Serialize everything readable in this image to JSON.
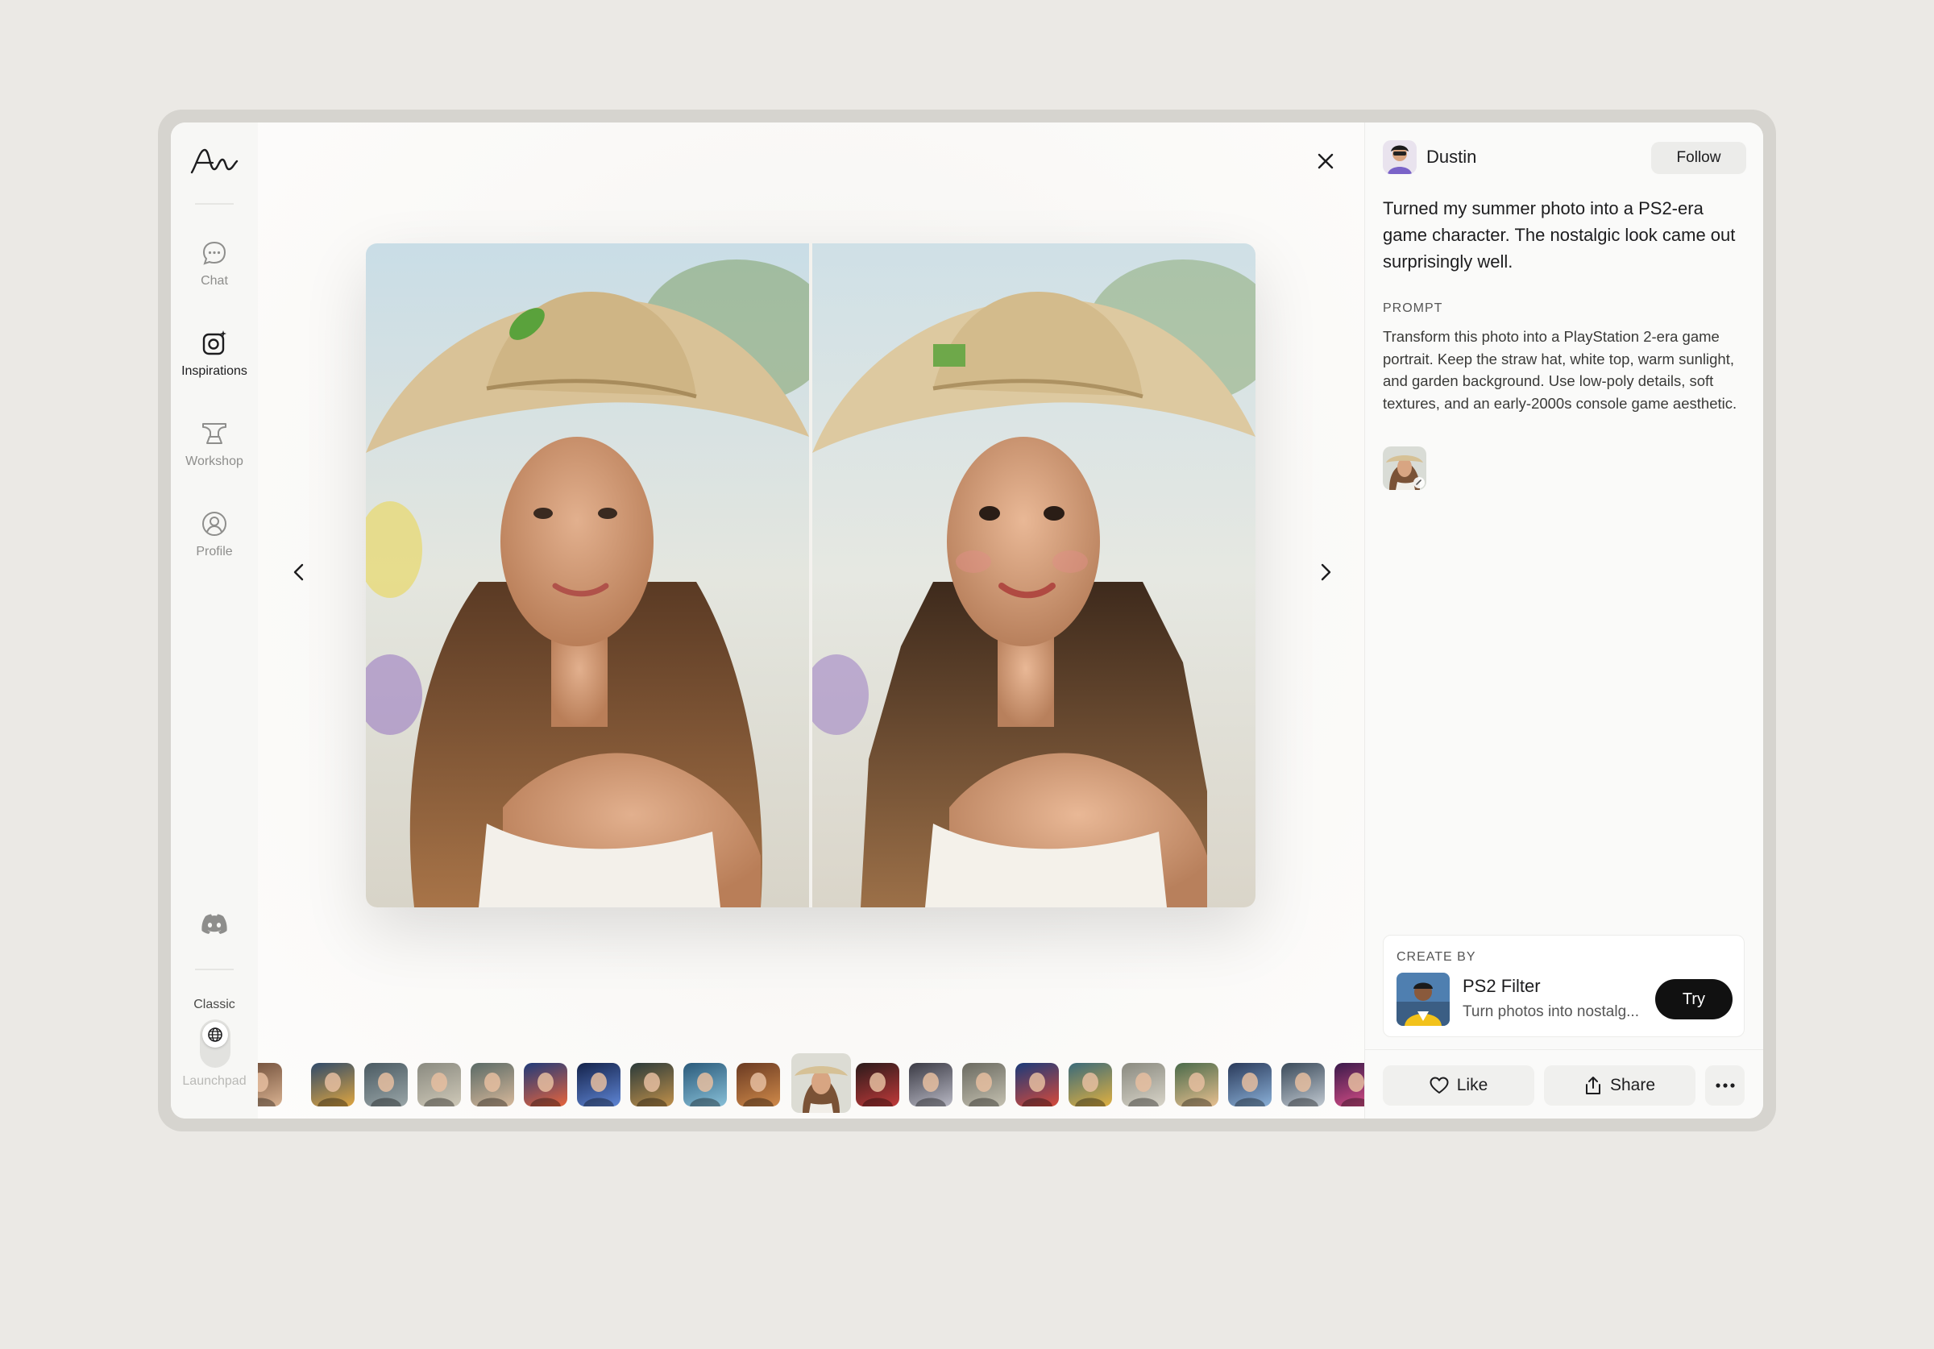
{
  "sidebar": {
    "nav": [
      {
        "label": "Chat",
        "icon": "chat-icon"
      },
      {
        "label": "Inspirations",
        "icon": "inspirations-icon",
        "active": true
      },
      {
        "label": "Workshop",
        "icon": "anvil-icon"
      },
      {
        "label": "Profile",
        "icon": "profile-icon"
      }
    ],
    "classic_label": "Classic",
    "launchpad_label": "Launchpad"
  },
  "post": {
    "author": "Dustin",
    "follow_label": "Follow",
    "description": "Turned my summer photo into a PS2-era game character. The nostalgic look came out surprisingly well.",
    "prompt_heading": "PROMPT",
    "prompt_text": "Transform this photo into a PlayStation 2-era game portrait. Keep the straw hat, white top, warm sunlight, and garden background. Use low-poly details, soft textures, and an early-2000s console game aesthetic."
  },
  "create_by": {
    "heading": "CREATE BY",
    "name": "PS2 Filter",
    "subtitle": "Turn photos into nostalg...",
    "try_label": "Try"
  },
  "actions": {
    "like_label": "Like",
    "share_label": "Share"
  },
  "colors": {
    "accent_dark": "#111111",
    "background": "#ebe9e5"
  }
}
